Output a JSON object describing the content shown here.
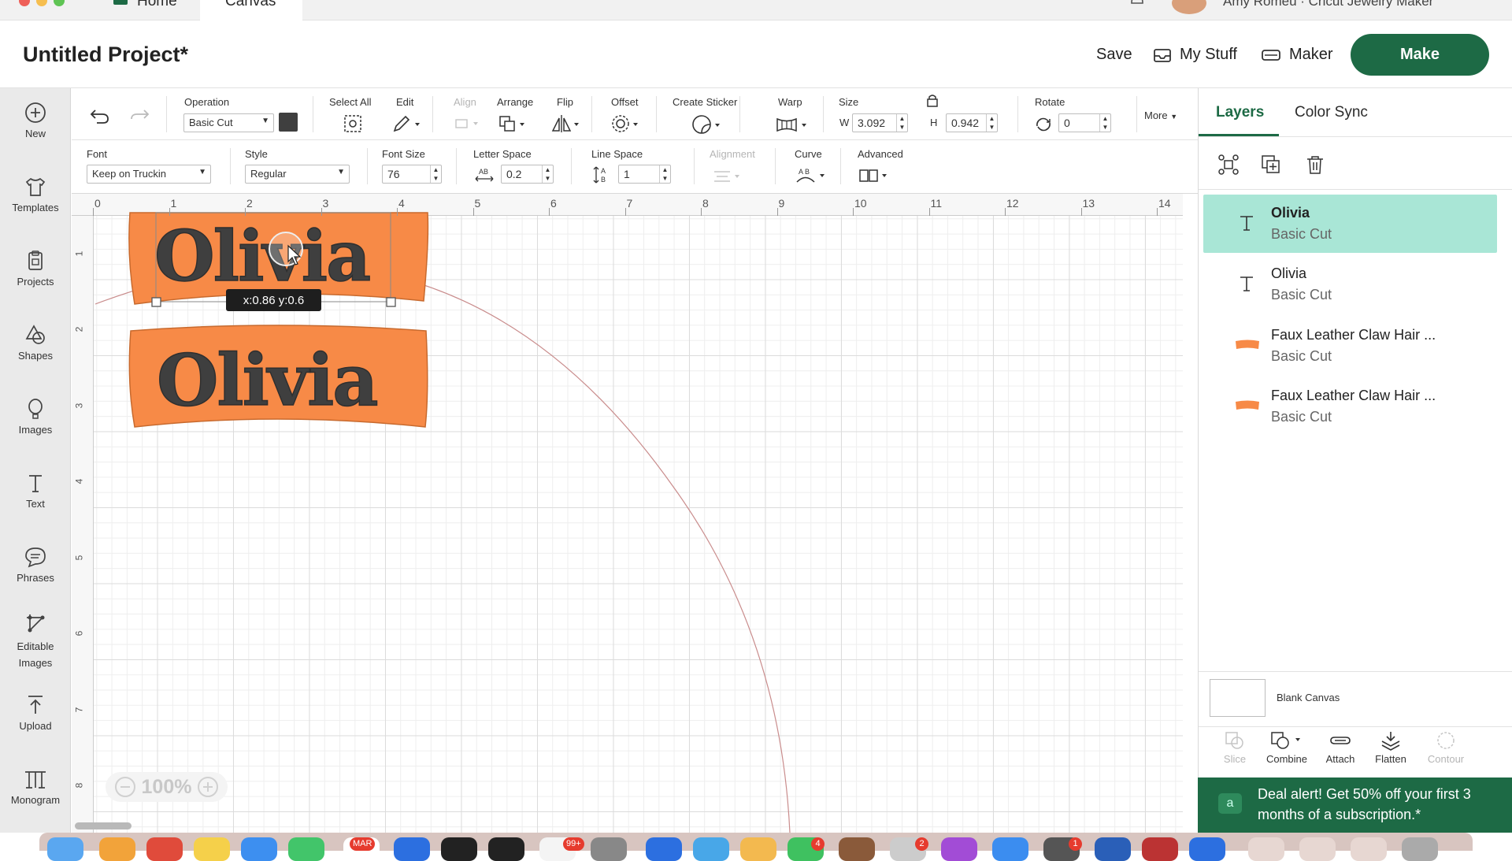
{
  "titlebar": {
    "tabs": [
      "Home",
      "Canvas"
    ],
    "account": "Amy Romeu · Cricut Jewelry Maker"
  },
  "header": {
    "title": "Untitled Project*",
    "save": "Save",
    "my_stuff": "My Stuff",
    "machine": "Maker",
    "make": "Make"
  },
  "sidebar": {
    "items": [
      {
        "label": "New",
        "icon": "plus-circle-icon"
      },
      {
        "label": "Templates",
        "icon": "shirt-icon"
      },
      {
        "label": "Projects",
        "icon": "clipboard-icon"
      },
      {
        "label": "Shapes",
        "icon": "shapes-icon"
      },
      {
        "label": "Images",
        "icon": "balloon-icon"
      },
      {
        "label": "Text",
        "icon": "text-icon"
      },
      {
        "label": "Phrases",
        "icon": "speech-bubble-icon"
      },
      {
        "label": "Editable Images",
        "icon": "editable-image-icon"
      },
      {
        "label": "Upload",
        "icon": "upload-icon"
      },
      {
        "label": "Monogram",
        "icon": "monogram-icon"
      }
    ]
  },
  "toolbar1": {
    "operation_label": "Operation",
    "operation_value": "Basic Cut",
    "select_all": "Select All",
    "edit": "Edit",
    "align": "Align",
    "arrange": "Arrange",
    "flip": "Flip",
    "offset": "Offset",
    "create_sticker": "Create Sticker",
    "warp": "Warp",
    "size": "Size",
    "w_label": "W",
    "w_value": "3.092",
    "h_label": "H",
    "h_value": "0.942",
    "rotate": "Rotate",
    "rotate_value": "0",
    "more": "More"
  },
  "toolbar2": {
    "font_label": "Font",
    "font_value": "Keep on Truckin",
    "style_label": "Style",
    "style_value": "Regular",
    "font_size_label": "Font Size",
    "font_size_value": "76",
    "letter_space_label": "Letter Space",
    "letter_space_value": "0.2",
    "line_space_label": "Line Space",
    "line_space_value": "1",
    "alignment_label": "Alignment",
    "curve_label": "Curve",
    "advanced_label": "Advanced"
  },
  "canvas": {
    "ruler_x": [
      "0",
      "1",
      "2",
      "3",
      "4",
      "5",
      "6",
      "7",
      "8",
      "9",
      "10",
      "11",
      "12",
      "13",
      "14"
    ],
    "ruler_y": [
      "1",
      "2",
      "3",
      "4",
      "5",
      "6",
      "7",
      "8"
    ],
    "tooltip": "x:0.86 y:0.6",
    "zoom": "100%",
    "design_text_top": "Olivia",
    "design_text_bottom": "Olivia",
    "colors": {
      "patch": "#f78a47",
      "text": "#3f3f3f",
      "arc": "#c98c8c"
    }
  },
  "rpanel": {
    "tabs": [
      "Layers",
      "Color Sync"
    ],
    "layers": [
      {
        "name": "Olivia",
        "op": "Basic Cut",
        "selected": true
      },
      {
        "name": "Olivia",
        "op": "Basic Cut",
        "selected": false
      },
      {
        "name": "Faux Leather Claw Hair ...",
        "op": "Basic Cut",
        "selected": false
      },
      {
        "name": "Faux Leather Claw Hair ...",
        "op": "Basic Cut",
        "selected": false
      }
    ],
    "blank_canvas": "Blank Canvas",
    "tools": [
      {
        "label": "Slice",
        "disabled": true
      },
      {
        "label": "Combine",
        "disabled": false
      },
      {
        "label": "Attach",
        "disabled": false
      },
      {
        "label": "Flatten",
        "disabled": false
      },
      {
        "label": "Contour",
        "disabled": true
      }
    ],
    "deal_line1": "Deal alert! Get 50% off your first 3",
    "deal_line2": "months of a subscription.*",
    "accent": "#1d6a45",
    "selected_bg": "#a9e6d6"
  },
  "dock": {
    "badges": [
      "MAR",
      "99+",
      "4",
      "2",
      "1"
    ]
  }
}
